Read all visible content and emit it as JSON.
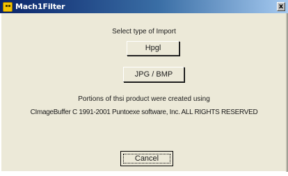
{
  "window": {
    "title": "Mach1Filter",
    "close_label": "x"
  },
  "dialog": {
    "prompt": "Select type of Import",
    "buttons": {
      "hpgl": "Hpgl",
      "jpg_bmp": "JPG / BMP",
      "cancel": "Cancel"
    },
    "credits_line1": "Portions of thsi product were created using",
    "credits_line2": "CImageBuffer C 1991-2001 Puntoexe software, Inc. ALL RIGHTS RESERVED"
  },
  "colors": {
    "title_gradient_start": "#0a246a",
    "title_gradient_end": "#a6caf0",
    "dialog_bg": "#ece9d8"
  }
}
